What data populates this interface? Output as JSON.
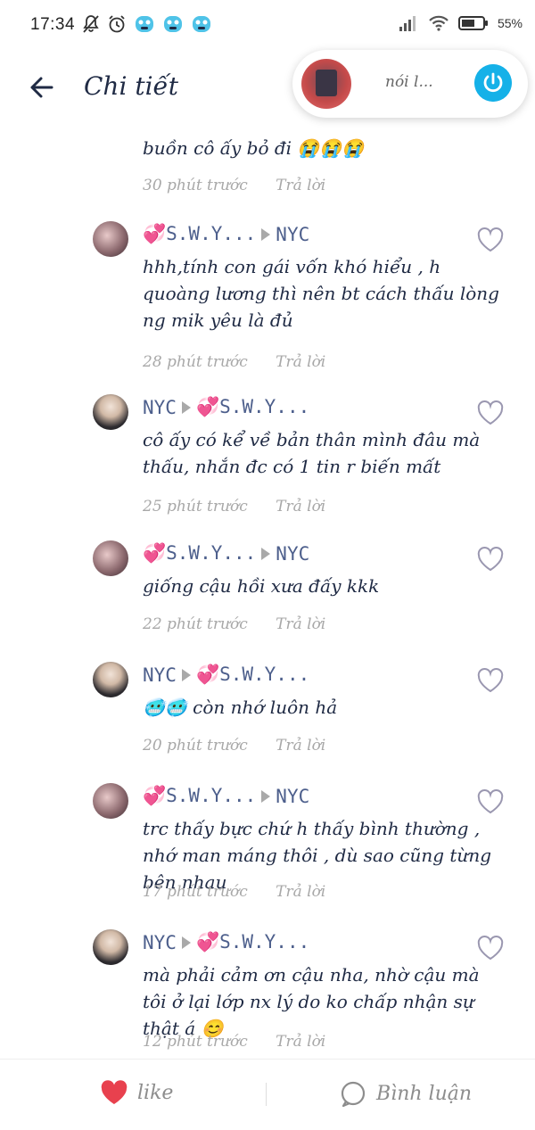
{
  "status_bar": {
    "time": "17:34",
    "battery": "55%"
  },
  "header": {
    "title": "Chi tiết"
  },
  "mini_player": {
    "text": "nói l..."
  },
  "partial_comment": {
    "text": "buồn cô ấy bỏ đi 😭😭😭",
    "time": "30 phút trước",
    "reply": "Trả lời"
  },
  "comments": [
    {
      "from": "💞S.W.Y...",
      "to": "NYC",
      "text": "hhh,tính con gái vốn khó hiểu , h quoàng lương thì nên bt cách thấu lòng ng mik yêu là đủ",
      "time": "28 phút trước",
      "reply": "Trả lời"
    },
    {
      "from": "NYC",
      "to": "💞S.W.Y...",
      "text": "cô ấy có kể về bản thân mình đâu mà thấu, nhắn đc có 1 tin r biến mất",
      "time": "25 phút trước",
      "reply": "Trả lời"
    },
    {
      "from": "💞S.W.Y...",
      "to": "NYC",
      "text": "giống cậu hồi xưa đấy kkk",
      "time": "22 phút trước",
      "reply": "Trả lời"
    },
    {
      "from": "NYC",
      "to": "💞S.W.Y...",
      "text": "🥶🥶 còn nhớ luôn hả",
      "time": "20 phút trước",
      "reply": "Trả lời"
    },
    {
      "from": "💞S.W.Y...",
      "to": "NYC",
      "text": "trc thấy bực chứ h thấy bình thường , nhớ man máng thôi , dù sao cũng từng bên nhau",
      "time": "17 phút trước",
      "reply": "Trả lời"
    },
    {
      "from": "NYC",
      "to": "💞S.W.Y...",
      "text": "mà phải cảm ơn cậu nha, nhờ cậu mà tôi ở lại lớp nx lý do ko chấp nhận sự thật á 😊",
      "time": "12 phút trước",
      "reply": "Trả lời"
    }
  ],
  "bottom_bar": {
    "like_label": "like",
    "comment_label": "Bình luận"
  },
  "colors": {
    "accent_blue": "#15b1e8",
    "like_red": "#e8414e",
    "name_blue": "#4d5f8c",
    "meta_gray": "#a8a8a8"
  }
}
